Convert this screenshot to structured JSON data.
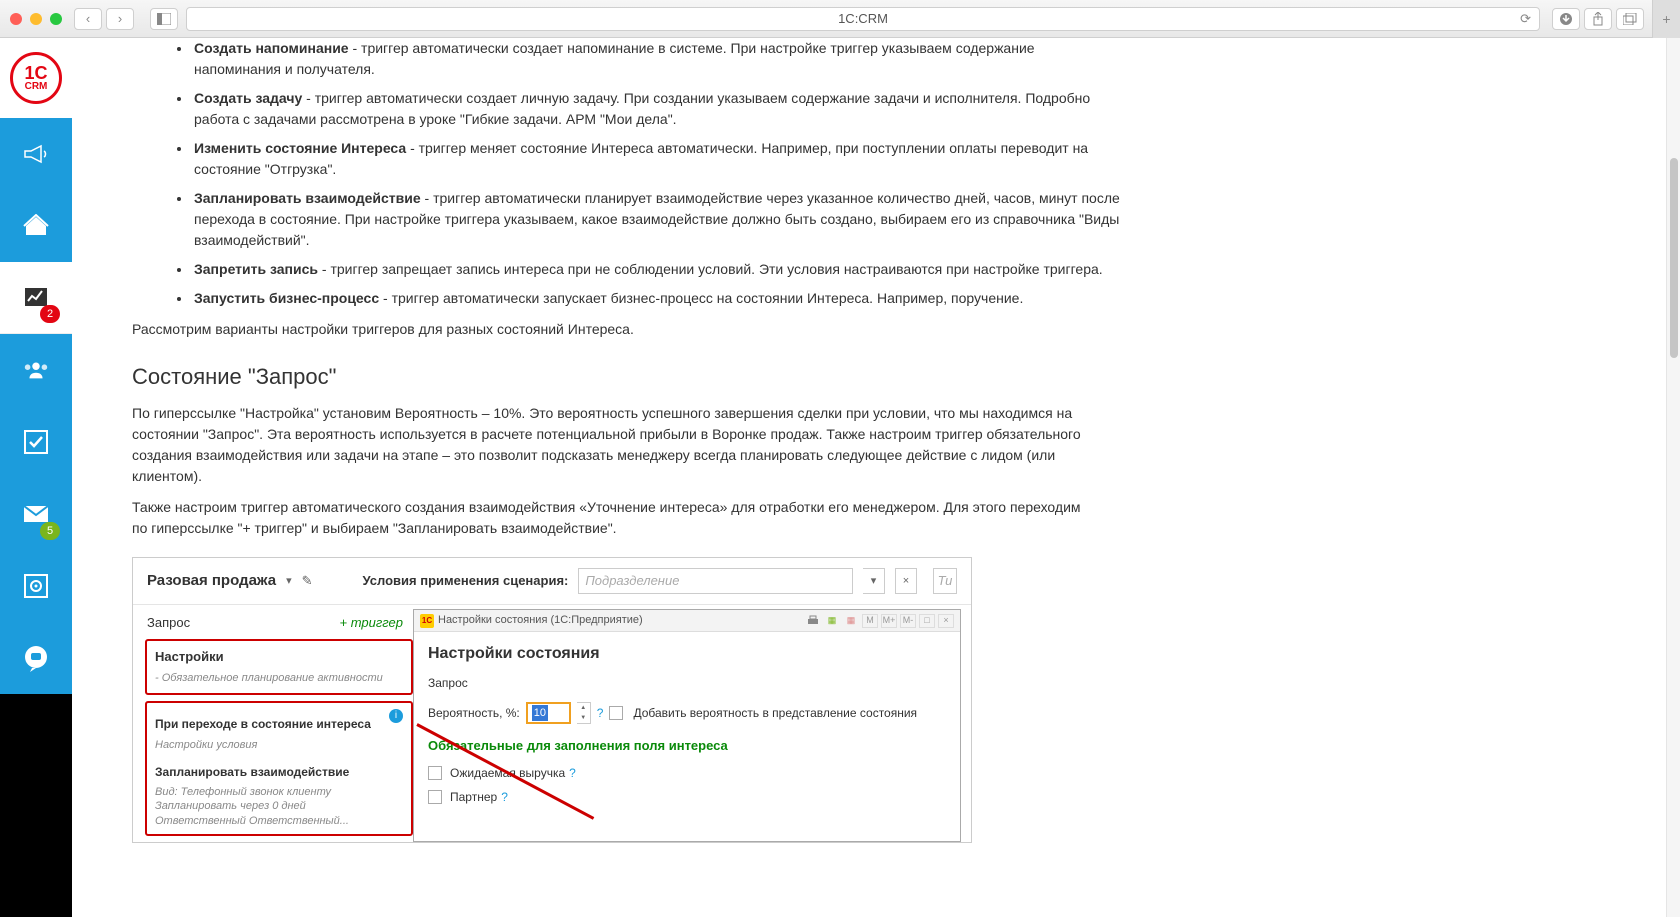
{
  "browser": {
    "title": "1C:CRM"
  },
  "sidebar": {
    "logo_top": "1C",
    "logo_bottom": "CRM",
    "badge_chart": "2",
    "badge_mail": "5"
  },
  "article": {
    "triggers": [
      {
        "name": "Создать напоминание",
        "desc": " - триггер автоматически создает напоминание в системе. При настройке триггер указываем содержание напоминания и получателя."
      },
      {
        "name": "Создать задачу",
        "desc": " - триггер автоматически создает личную задачу. При создании указываем содержание задачи и исполнителя. Подробно работа с задачами рассмотрена в уроке \"Гибкие задачи. АРМ \"Мои дела\"."
      },
      {
        "name": "Изменить состояние Интереса",
        "desc": " - триггер меняет состояние Интереса автоматически. Например, при поступлении оплаты переводит на состояние \"Отгрузка\"."
      },
      {
        "name": "Запланировать взаимодействие",
        "desc": " - триггер автоматически планирует взаимодействие через указанное количество дней, часов, минут после перехода в состояние. При настройке триггера указываем, какое взаимодействие должно быть создано, выбираем его из справочника \"Виды взаимодействий\"."
      },
      {
        "name": "Запретить запись",
        "desc": " - триггер запрещает запись интереса при не соблюдении условий. Эти условия настраиваются при настройке триггера."
      },
      {
        "name": "Запустить бизнес-процесс",
        "desc": " - триггер автоматически запускает бизнес-процесс на состоянии Интереса. Например, поручение."
      }
    ],
    "p1": "Рассмотрим варианты настройки триггеров для разных состояний Интереса.",
    "h2": "Состояние \"Запрос\"",
    "p2": "По гиперссылке \"Настройка\" установим Вероятность – 10%. Это вероятность успешного завершения сделки при условии, что мы находимся на состоянии \"Запрос\". Эта вероятность используется в расчете потенциальной прибыли в Воронке продаж. Также настроим триггер обязательного создания взаимодействия или задачи на этапе – это позволит подсказать менеджеру всегда планировать следующее действие с лидом (или клиентом).",
    "p3": "Также настроим триггер автоматического создания взаимодействия «Уточнение интереса» для отработки его менеджером. Для этого переходим по гиперссылке \"+ триггер\" и выбираем \"Запланировать взаимодействие\"."
  },
  "inset": {
    "title": "Разовая продажа",
    "cond_label": "Условия применения сценария:",
    "cond_placeholder": "Подразделение",
    "tip": "Ти",
    "left": {
      "state": "Запрос",
      "trigger_link": "+ триггер",
      "box1_hdr": "Настройки",
      "box1_sub": "- Обязательное планирование активности",
      "box2_hdr": "При переходе в состояние интереса",
      "box2_sub": "Настройки условия",
      "box2_plan": "Запланировать взаимодействие",
      "box2_fine1": "Вид: Телефонный звонок клиенту",
      "box2_fine2": "Запланировать через 0 дней",
      "box2_fine3": "Ответственный Ответственный..."
    },
    "dialog": {
      "wintitle": "Настройки состояния  (1С:Предприятие)",
      "m": "M",
      "mplus": "M+",
      "mminus": "M-",
      "h3": "Настройки состояния",
      "state": "Запрос",
      "prob_label": "Вероятность, %:",
      "prob_value": "10",
      "add_prob": "Добавить вероятность в представление состояния",
      "green": "Обязательные для заполнения поля интереса",
      "chk1": "Ожидаемая выручка",
      "chk2": "Партнер"
    }
  }
}
